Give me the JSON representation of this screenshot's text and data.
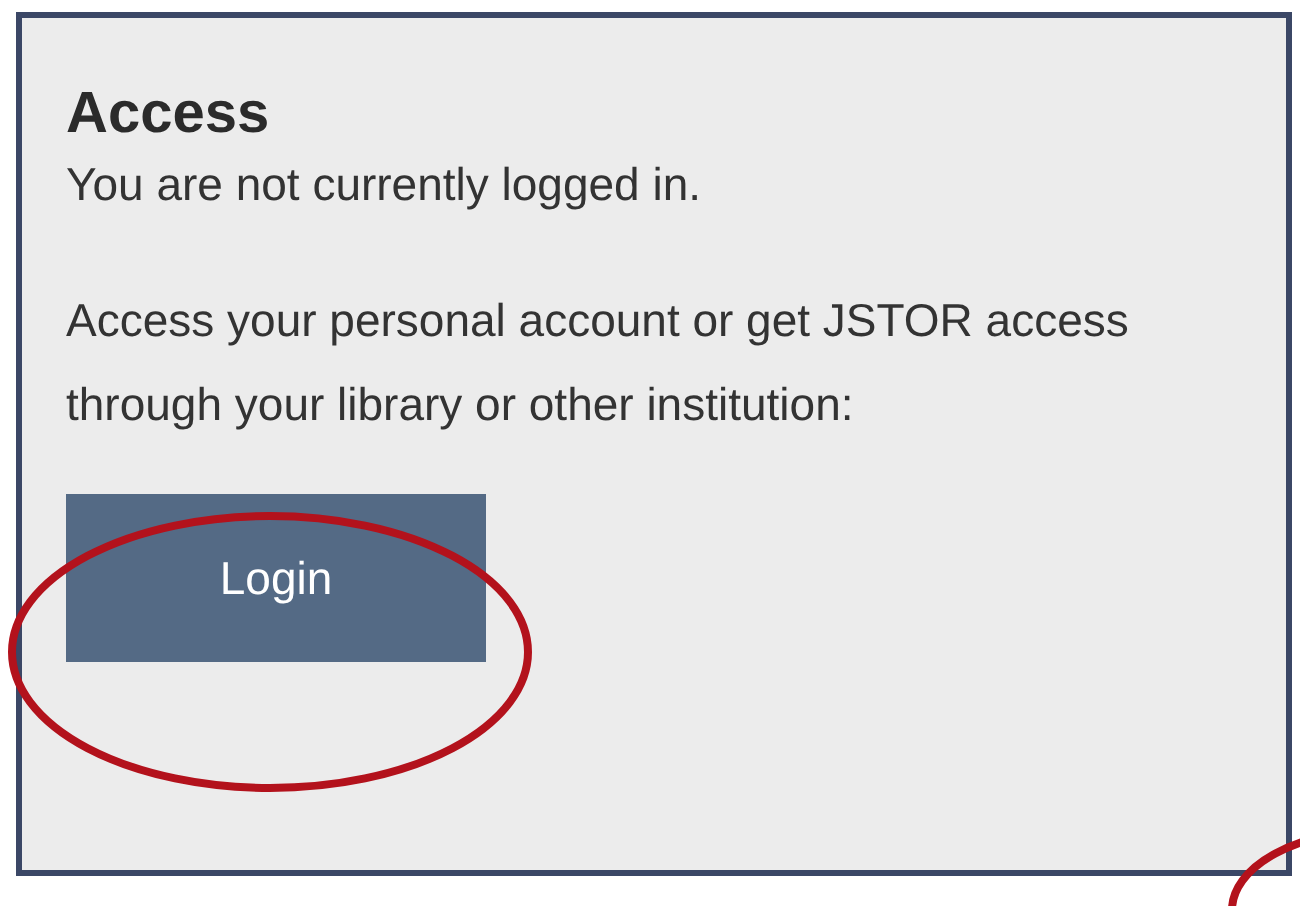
{
  "panel": {
    "title": "Access",
    "status": "You are not currently logged in.",
    "instructions": "Access your personal account or get JSTOR access through your library or other institution:",
    "button": "Login"
  }
}
